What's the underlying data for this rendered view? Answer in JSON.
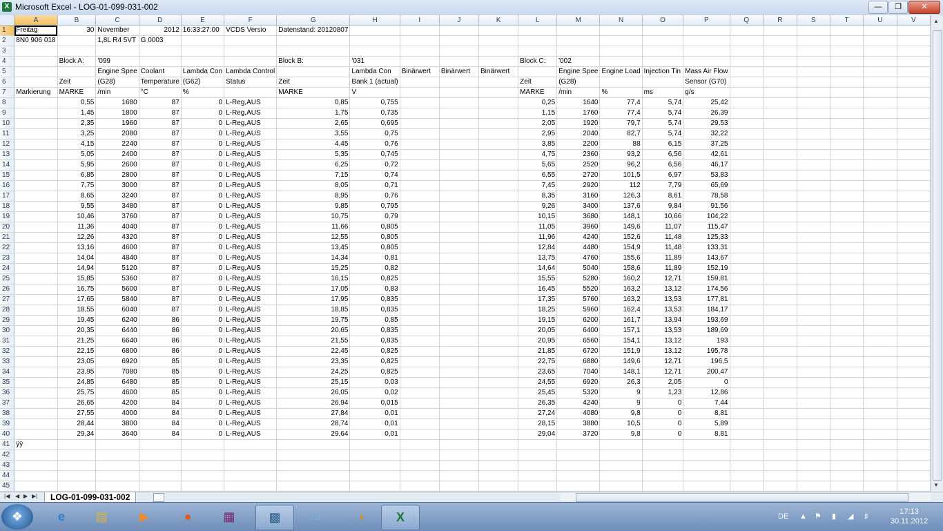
{
  "window": {
    "title": "Microsoft Excel - LOG-01-099-031-002",
    "app_icon": "X"
  },
  "columns": [
    "A",
    "B",
    "C",
    "D",
    "E",
    "F",
    "G",
    "H",
    "I",
    "J",
    "K",
    "L",
    "M",
    "N",
    "O",
    "P",
    "Q",
    "R",
    "S",
    "T",
    "U",
    "V"
  ],
  "rows": [
    [
      "Freitag",
      "30",
      "November",
      "2012",
      "16:33:27:00",
      "VCDS Versio",
      "Datenstand: 20120807",
      "",
      "",
      "",
      "",
      "",
      "",
      "",
      "",
      "",
      "",
      "",
      "",
      "",
      "",
      ""
    ],
    [
      "8N0 906 018",
      "",
      "1,8L R4 5VT",
      "G  0003",
      "",
      "",
      "",
      "",
      "",
      "",
      "",
      "",
      "",
      "",
      "",
      "",
      "",
      "",
      "",
      "",
      "",
      ""
    ],
    [
      "",
      "",
      "",
      "",
      "",
      "",
      "",
      "",
      "",
      "",
      "",
      "",
      "",
      "",
      "",
      "",
      "",
      "",
      "",
      "",
      "",
      ""
    ],
    [
      "",
      "Block A:",
      "'099",
      "",
      "",
      "",
      "Block B:",
      "'031",
      "",
      "",
      "",
      "Block C:",
      "'002",
      "",
      "",
      "",
      "",
      "",
      "",
      "",
      "",
      ""
    ],
    [
      "",
      "",
      "Engine Spee",
      "Coolant",
      "Lambda Con",
      "Lambda Control",
      "",
      "Lambda Con",
      "Binärwert",
      "Binärwert",
      "Binärwert",
      "",
      "Engine Spee",
      "Engine Load",
      "Injection Tin",
      "Mass Air Flow",
      "",
      "",
      "",
      "",
      "",
      ""
    ],
    [
      "",
      "Zeit",
      "(G28)",
      "Temperature",
      "(G62)",
      "Status",
      "Zeit",
      "Bank 1 (actual)",
      "",
      "",
      "",
      "Zeit",
      "(G28)",
      "",
      "",
      "Sensor (G70)",
      "",
      "",
      "",
      "",
      "",
      ""
    ],
    [
      "Markierung",
      "MARKE",
      "/min",
      "°C",
      "%",
      "",
      "MARKE",
      "V",
      "",
      "",
      "",
      "MARKE",
      "/min",
      "%",
      "ms",
      "g/s",
      "",
      "",
      "",
      "",
      "",
      ""
    ],
    [
      "",
      "0,55",
      "1680",
      "87",
      "0",
      "L-Reg,AUS",
      "0,85",
      "0,755",
      "",
      "",
      "",
      "0,25",
      "1640",
      "77,4",
      "5,74",
      "25,42",
      "",
      "",
      "",
      "",
      "",
      ""
    ],
    [
      "",
      "1,45",
      "1800",
      "87",
      "0",
      "L-Reg,AUS",
      "1,75",
      "0,735",
      "",
      "",
      "",
      "1,15",
      "1760",
      "77,4",
      "5,74",
      "26,39",
      "",
      "",
      "",
      "",
      "",
      ""
    ],
    [
      "",
      "2,35",
      "1960",
      "87",
      "0",
      "L-Reg,AUS",
      "2,65",
      "0,695",
      "",
      "",
      "",
      "2,05",
      "1920",
      "79,7",
      "5,74",
      "29,53",
      "",
      "",
      "",
      "",
      "",
      ""
    ],
    [
      "",
      "3,25",
      "2080",
      "87",
      "0",
      "L-Reg,AUS",
      "3,55",
      "0,75",
      "",
      "",
      "",
      "2,95",
      "2040",
      "82,7",
      "5,74",
      "32,22",
      "",
      "",
      "",
      "",
      "",
      ""
    ],
    [
      "",
      "4,15",
      "2240",
      "87",
      "0",
      "L-Reg,AUS",
      "4,45",
      "0,76",
      "",
      "",
      "",
      "3,85",
      "2200",
      "88",
      "6,15",
      "37,25",
      "",
      "",
      "",
      "",
      "",
      ""
    ],
    [
      "",
      "5,05",
      "2400",
      "87",
      "0",
      "L-Reg,AUS",
      "5,35",
      "0,745",
      "",
      "",
      "",
      "4,75",
      "2360",
      "93,2",
      "6,56",
      "42,61",
      "",
      "",
      "",
      "",
      "",
      ""
    ],
    [
      "",
      "5,95",
      "2600",
      "87",
      "0",
      "L-Reg,AUS",
      "6,25",
      "0,72",
      "",
      "",
      "",
      "5,65",
      "2520",
      "96,2",
      "6,56",
      "46,17",
      "",
      "",
      "",
      "",
      "",
      ""
    ],
    [
      "",
      "6,85",
      "2800",
      "87",
      "0",
      "L-Reg,AUS",
      "7,15",
      "0,74",
      "",
      "",
      "",
      "6,55",
      "2720",
      "101,5",
      "6,97",
      "53,83",
      "",
      "",
      "",
      "",
      "",
      ""
    ],
    [
      "",
      "7,75",
      "3000",
      "87",
      "0",
      "L-Reg,AUS",
      "8,05",
      "0,71",
      "",
      "",
      "",
      "7,45",
      "2920",
      "112",
      "7,79",
      "65,69",
      "",
      "",
      "",
      "",
      "",
      ""
    ],
    [
      "",
      "8,65",
      "3240",
      "87",
      "0",
      "L-Reg,AUS",
      "8,95",
      "0,76",
      "",
      "",
      "",
      "8,35",
      "3160",
      "126,3",
      "8,61",
      "78,58",
      "",
      "",
      "",
      "",
      "",
      ""
    ],
    [
      "",
      "9,55",
      "3480",
      "87",
      "0",
      "L-Reg,AUS",
      "9,85",
      "0,795",
      "",
      "",
      "",
      "9,26",
      "3400",
      "137,6",
      "9,84",
      "91,56",
      "",
      "",
      "",
      "",
      "",
      ""
    ],
    [
      "",
      "10,46",
      "3760",
      "87",
      "0",
      "L-Reg,AUS",
      "10,75",
      "0,79",
      "",
      "",
      "",
      "10,15",
      "3680",
      "148,1",
      "10,66",
      "104,22",
      "",
      "",
      "",
      "",
      "",
      ""
    ],
    [
      "",
      "11,36",
      "4040",
      "87",
      "0",
      "L-Reg,AUS",
      "11,66",
      "0,805",
      "",
      "",
      "",
      "11,05",
      "3960",
      "149,6",
      "11,07",
      "115,47",
      "",
      "",
      "",
      "",
      "",
      ""
    ],
    [
      "",
      "12,26",
      "4320",
      "87",
      "0",
      "L-Reg,AUS",
      "12,55",
      "0,805",
      "",
      "",
      "",
      "11,96",
      "4240",
      "152,6",
      "11,48",
      "125,33",
      "",
      "",
      "",
      "",
      "",
      ""
    ],
    [
      "",
      "13,16",
      "4600",
      "87",
      "0",
      "L-Reg,AUS",
      "13,45",
      "0,805",
      "",
      "",
      "",
      "12,84",
      "4480",
      "154,9",
      "11,48",
      "133,31",
      "",
      "",
      "",
      "",
      "",
      ""
    ],
    [
      "",
      "14,04",
      "4840",
      "87",
      "0",
      "L-Reg,AUS",
      "14,34",
      "0,81",
      "",
      "",
      "",
      "13,75",
      "4760",
      "155,6",
      "11,89",
      "143,67",
      "",
      "",
      "",
      "",
      "",
      ""
    ],
    [
      "",
      "14,94",
      "5120",
      "87",
      "0",
      "L-Reg,AUS",
      "15,25",
      "0,82",
      "",
      "",
      "",
      "14,64",
      "5040",
      "158,6",
      "11,89",
      "152,19",
      "",
      "",
      "",
      "",
      "",
      ""
    ],
    [
      "",
      "15,85",
      "5360",
      "87",
      "0",
      "L-Reg,AUS",
      "16,15",
      "0,825",
      "",
      "",
      "",
      "15,55",
      "5280",
      "160,2",
      "12,71",
      "159,81",
      "",
      "",
      "",
      "",
      "",
      ""
    ],
    [
      "",
      "16,75",
      "5600",
      "87",
      "0",
      "L-Reg,AUS",
      "17,05",
      "0,83",
      "",
      "",
      "",
      "16,45",
      "5520",
      "163,2",
      "13,12",
      "174,56",
      "",
      "",
      "",
      "",
      "",
      ""
    ],
    [
      "",
      "17,65",
      "5840",
      "87",
      "0",
      "L-Reg,AUS",
      "17,95",
      "0,835",
      "",
      "",
      "",
      "17,35",
      "5760",
      "163,2",
      "13,53",
      "177,81",
      "",
      "",
      "",
      "",
      "",
      ""
    ],
    [
      "",
      "18,55",
      "6040",
      "87",
      "0",
      "L-Reg,AUS",
      "18,85",
      "0,835",
      "",
      "",
      "",
      "18,25",
      "5960",
      "162,4",
      "13,53",
      "184,17",
      "",
      "",
      "",
      "",
      "",
      ""
    ],
    [
      "",
      "19,45",
      "6240",
      "86",
      "0",
      "L-Reg,AUS",
      "19,75",
      "0,85",
      "",
      "",
      "",
      "19,15",
      "6200",
      "161,7",
      "13,94",
      "193,69",
      "",
      "",
      "",
      "",
      "",
      ""
    ],
    [
      "",
      "20,35",
      "6440",
      "86",
      "0",
      "L-Reg,AUS",
      "20,65",
      "0,835",
      "",
      "",
      "",
      "20,05",
      "6400",
      "157,1",
      "13,53",
      "189,69",
      "",
      "",
      "",
      "",
      "",
      ""
    ],
    [
      "",
      "21,25",
      "6640",
      "86",
      "0",
      "L-Reg,AUS",
      "21,55",
      "0,835",
      "",
      "",
      "",
      "20,95",
      "6560",
      "154,1",
      "13,12",
      "193",
      "",
      "",
      "",
      "",
      "",
      ""
    ],
    [
      "",
      "22,15",
      "6800",
      "86",
      "0",
      "L-Reg,AUS",
      "22,45",
      "0,825",
      "",
      "",
      "",
      "21,85",
      "6720",
      "151,9",
      "13,12",
      "195,78",
      "",
      "",
      "",
      "",
      "",
      ""
    ],
    [
      "",
      "23,05",
      "6920",
      "85",
      "0",
      "L-Reg,AUS",
      "23,35",
      "0,825",
      "",
      "",
      "",
      "22,75",
      "6880",
      "149,6",
      "12,71",
      "196,5",
      "",
      "",
      "",
      "",
      "",
      ""
    ],
    [
      "",
      "23,95",
      "7080",
      "85",
      "0",
      "L-Reg,AUS",
      "24,25",
      "0,825",
      "",
      "",
      "",
      "23,65",
      "7040",
      "148,1",
      "12,71",
      "200,47",
      "",
      "",
      "",
      "",
      "",
      ""
    ],
    [
      "",
      "24,85",
      "6480",
      "85",
      "0",
      "L-Reg,AUS",
      "25,15",
      "0,03",
      "",
      "",
      "",
      "24,55",
      "6920",
      "26,3",
      "2,05",
      "0",
      "",
      "",
      "",
      "",
      "",
      ""
    ],
    [
      "",
      "25,75",
      "4600",
      "85",
      "0",
      "L-Reg,AUS",
      "26,05",
      "0,02",
      "",
      "",
      "",
      "25,45",
      "5320",
      "9",
      "1,23",
      "12,86",
      "",
      "",
      "",
      "",
      "",
      ""
    ],
    [
      "",
      "26,65",
      "4200",
      "84",
      "0",
      "L-Reg,AUS",
      "26,94",
      "0,015",
      "",
      "",
      "",
      "26,35",
      "4240",
      "9",
      "0",
      "7,44",
      "",
      "",
      "",
      "",
      "",
      ""
    ],
    [
      "",
      "27,55",
      "4000",
      "84",
      "0",
      "L-Reg,AUS",
      "27,84",
      "0,01",
      "",
      "",
      "",
      "27,24",
      "4080",
      "9,8",
      "0",
      "8,81",
      "",
      "",
      "",
      "",
      "",
      ""
    ],
    [
      "",
      "28,44",
      "3800",
      "84",
      "0",
      "L-Reg,AUS",
      "28,74",
      "0,01",
      "",
      "",
      "",
      "28,15",
      "3880",
      "10,5",
      "0",
      "5,89",
      "",
      "",
      "",
      "",
      "",
      ""
    ],
    [
      "",
      "29,34",
      "3640",
      "84",
      "0",
      "L-Reg,AUS",
      "29,64",
      "0,01",
      "",
      "",
      "",
      "29,04",
      "3720",
      "9,8",
      "0",
      "8,81",
      "",
      "",
      "",
      "",
      "",
      ""
    ],
    [
      "ÿÿ",
      "",
      "",
      "",
      "",
      "",
      "",
      "",
      "",
      "",
      "",
      "",
      "",
      "",
      "",
      "",
      "",
      "",
      "",
      "",
      "",
      ""
    ],
    [
      "",
      "",
      "",
      "",
      "",
      "",
      "",
      "",
      "",
      "",
      "",
      "",
      "",
      "",
      "",
      "",
      "",
      "",
      "",
      "",
      "",
      ""
    ],
    [
      "",
      "",
      "",
      "",
      "",
      "",
      "",
      "",
      "",
      "",
      "",
      "",
      "",
      "",
      "",
      "",
      "",
      "",
      "",
      "",
      "",
      ""
    ],
    [
      "",
      "",
      "",
      "",
      "",
      "",
      "",
      "",
      "",
      "",
      "",
      "",
      "",
      "",
      "",
      "",
      "",
      "",
      "",
      "",
      "",
      ""
    ],
    [
      "",
      "",
      "",
      "",
      "",
      "",
      "",
      "",
      "",
      "",
      "",
      "",
      "",
      "",
      "",
      "",
      "",
      "",
      "",
      "",
      "",
      ""
    ]
  ],
  "sheet_tabs": [
    "LOG-01-099-031-002"
  ],
  "taskbar": {
    "language": "DE",
    "time": "17:13",
    "date": "30.11.2012",
    "apps": [
      "ie-icon",
      "explorer-icon",
      "media-player-icon",
      "firefox-icon",
      "winrar-icon",
      "app-icon",
      "paint-icon",
      "excel-icon"
    ]
  },
  "colors": {
    "header_bg": "#e4ecf7",
    "selected_header": "#f1c15f",
    "taskbar": "#6d8db8"
  }
}
